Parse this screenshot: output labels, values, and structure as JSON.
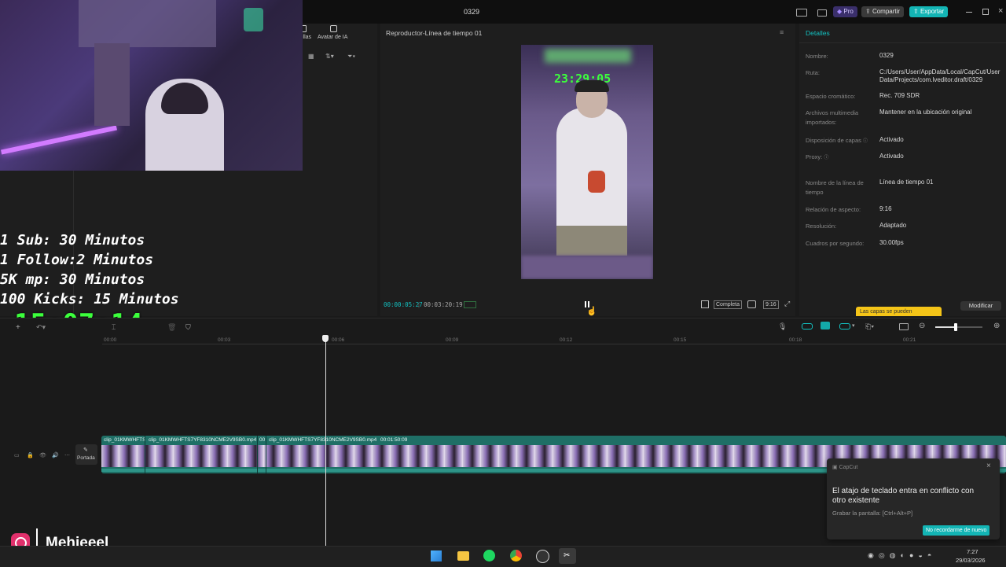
{
  "window": {
    "title": "0329",
    "pro_label": "Pro",
    "share_label": "Compartir",
    "export_label": "Exportar"
  },
  "left_panel": {
    "tab_subtitles_fragment": "illas",
    "tab_ai_avatar": "Avatar de IA"
  },
  "player": {
    "title": "Reproductor-Línea de tiempo 01",
    "current_time": "00:00:05:27",
    "total_time": "00:03:20:19",
    "full_label": "Completa",
    "ratio_label": "9:16",
    "video_clock": "23:29:05"
  },
  "details": {
    "title": "Detalles",
    "rows": [
      {
        "label": "Nombre:",
        "value": "0329"
      },
      {
        "label": "Ruta:",
        "value": "C:/Users/User/AppData/Local/CapCut/User Data/Projects/com.lveditor.draft/0329"
      },
      {
        "label": "Espacio cromático:",
        "value": "Rec. 709 SDR"
      },
      {
        "label": "Archivos multimedia importados:",
        "value": "Mantener en la ubicación original"
      },
      {
        "label": "Disposición de capas",
        "value": "Activado"
      },
      {
        "label": "Proxy:",
        "value": "Activado"
      },
      {
        "label": "Nombre de la línea de tiempo",
        "value": "Línea de tiempo 01"
      },
      {
        "label": "Relación de aspecto:",
        "value": "9:16"
      },
      {
        "label": "Resolución:",
        "value": "Adaptado"
      },
      {
        "label": "Cuadros por segundo:",
        "value": "30.00fps"
      }
    ],
    "layers_tooltip": "Las capas se pueden",
    "modify_label": "Modificar"
  },
  "stream_overlay": {
    "lines": [
      "1 Sub: 30 Minutos",
      "1 Follow:2 Minutos",
      "5K mp: 30 Minutos",
      "100 Kicks: 15 Minutos"
    ],
    "countdown": "15:07:14",
    "handle": "Mehieeel"
  },
  "timeline": {
    "ticks": [
      "00:00",
      "00:03",
      "00:06",
      "00:09",
      "00:12",
      "00:15",
      "00:18",
      "00:21"
    ],
    "cover_label": "Portada",
    "clips": [
      {
        "label": "clip_01KMWHFTS"
      },
      {
        "label": "clip_01KMWHFTS7YF8310NCME2V9SB0.mp4"
      },
      {
        "label": "00"
      },
      {
        "label": "clip_01KMWHFTS7YF8310NCME2V9SB0.mp4"
      },
      {
        "label": "00:01:50:09"
      }
    ]
  },
  "notification": {
    "app": "CapCut",
    "title": "El atajo de teclado entra en conflicto con otro existente",
    "body": "Grabar la pantalla: [Ctrl+Alt+P]",
    "button": "No recordarme de nuevo"
  },
  "taskbar": {
    "time": "7:27",
    "date": "29/03/2026"
  },
  "colors": {
    "accent": "#13c2c2",
    "pro": "#6b4fd8",
    "countdown": "#3cff3c",
    "clip": "#1f7f73"
  }
}
